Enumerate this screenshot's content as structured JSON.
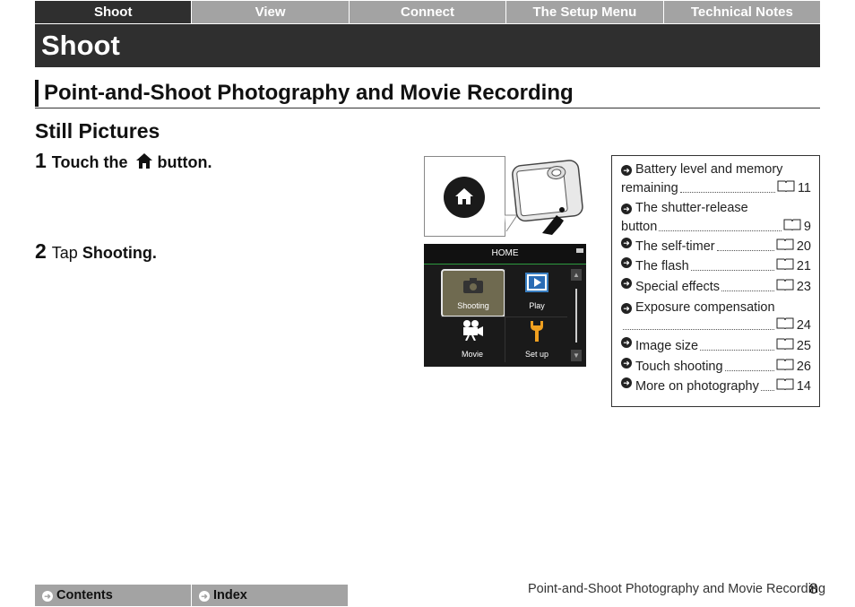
{
  "tabs": [
    "Shoot",
    "View",
    "Connect",
    "The Setup Menu",
    "Technical Notes"
  ],
  "active_tab": "Shoot",
  "banner_title": "Shoot",
  "section_title": "Point-and-Shoot Photography and Movie Recording",
  "subsection_title": "Still Pictures",
  "steps": [
    {
      "num": "1",
      "pre": "Touch the",
      "post": "button."
    },
    {
      "num": "2",
      "pre": "Tap",
      "bold": "Shooting."
    }
  ],
  "screen": {
    "header": "HOME",
    "items": [
      "Shooting",
      "Play",
      "Movie",
      "Set up"
    ]
  },
  "sidebox": [
    {
      "line1": "Battery level and memory",
      "line2": "remaining",
      "page": "11"
    },
    {
      "line1": "The shutter-release",
      "line2": "button",
      "page": "9"
    },
    {
      "line1": "The self-timer",
      "page": "20"
    },
    {
      "line1": "The flash",
      "page": "21"
    },
    {
      "line1": "Special effects",
      "page": "23"
    },
    {
      "line1": "Exposure compensation",
      "line2": "",
      "page": "24"
    },
    {
      "line1": "Image size",
      "page": "25"
    },
    {
      "line1": "Touch shooting",
      "page": "26"
    },
    {
      "line1": "More on photography",
      "page": "14"
    }
  ],
  "footer": {
    "contents": "Contents",
    "index": "Index",
    "running_title": "Point-and-Shoot Photography and Movie Recording",
    "page_number": "8"
  }
}
